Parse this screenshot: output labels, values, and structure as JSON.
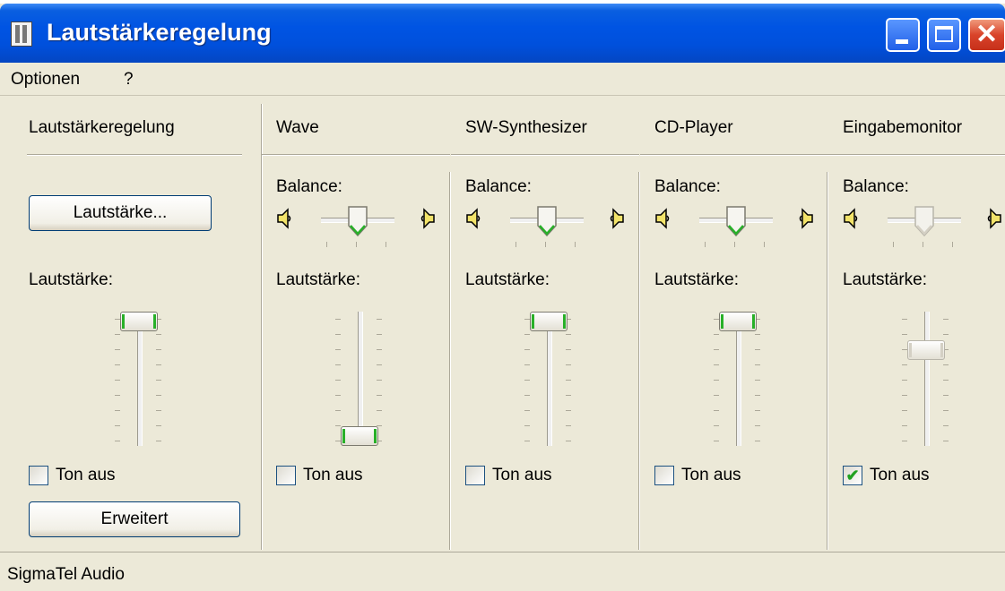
{
  "window": {
    "title": "Lautstärkeregelung"
  },
  "menu": {
    "items": [
      "Optionen",
      "?"
    ]
  },
  "master": {
    "title": "Lautstärkeregelung",
    "button_label": "Lautstärke...",
    "volume_label": "Lautstärke:",
    "volume_level": 1.0,
    "mute_label": "Ton aus",
    "mute_checked": false,
    "advanced_label": "Erweitert"
  },
  "channels": [
    {
      "title": "Wave",
      "balance_label": "Balance:",
      "volume_label": "Lautstärke:",
      "volume_level": 0.0,
      "mute_label": "Ton aus",
      "mute_checked": false,
      "enabled": true
    },
    {
      "title": "SW-Synthesizer",
      "balance_label": "Balance:",
      "volume_label": "Lautstärke:",
      "volume_level": 1.0,
      "mute_label": "Ton aus",
      "mute_checked": false,
      "enabled": true
    },
    {
      "title": "CD-Player",
      "balance_label": "Balance:",
      "volume_label": "Lautstärke:",
      "volume_level": 1.0,
      "mute_label": "Ton aus",
      "mute_checked": false,
      "enabled": true
    },
    {
      "title": "Eingabemonitor",
      "balance_label": "Balance:",
      "volume_label": "Lautstärke:",
      "volume_level": 0.75,
      "mute_label": "Ton aus",
      "mute_checked": true,
      "enabled": false
    }
  ],
  "status": {
    "text": "SigmaTel Audio"
  },
  "colors": {
    "titlebar": "#0054e3",
    "face": "#ece9d8",
    "thumb_accent": "#28b028"
  },
  "icons": {
    "left_speaker": "speaker-left-icon",
    "right_speaker": "speaker-right-icon"
  }
}
